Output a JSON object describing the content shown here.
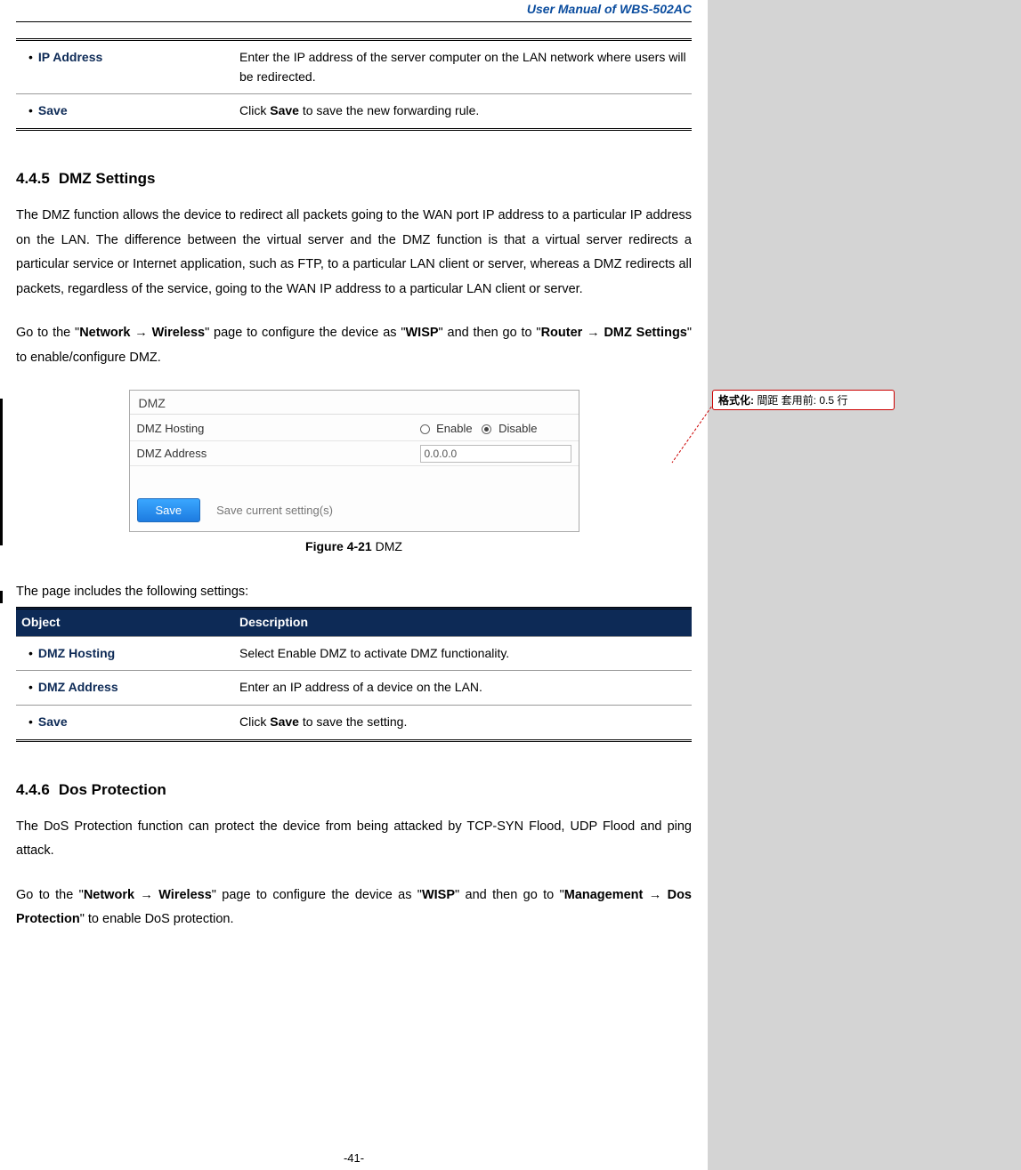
{
  "doc_title": "User Manual of WBS-502AC",
  "table1": {
    "rows": [
      {
        "obj": "IP Address",
        "desc": "Enter the IP address of the server computer on the LAN network where users will be redirected."
      },
      {
        "obj": "Save",
        "desc_pre": "Click ",
        "desc_bold": "Save",
        "desc_post": " to save the new forwarding rule."
      }
    ]
  },
  "sec445": {
    "number": "4.4.5",
    "title": "DMZ Settings",
    "para1": "The DMZ function allows the device to redirect all packets going to the WAN port IP address to a particular IP address on the LAN. The difference between the virtual server and the DMZ function is that a virtual server redirects a particular service or Internet application, such as FTP, to a particular LAN client or server, whereas a DMZ redirects all packets, regardless of the service, going to the WAN IP address to a particular LAN client or server.",
    "para2_pre": "Go to the \"",
    "para2_nav1a": "Network",
    "para2_nav1b": "Wireless",
    "para2_mid": "\" page to configure the device as \"",
    "para2_wisp": "WISP",
    "para2_mid2": "\" and then go to \"",
    "para2_nav2a": "Router",
    "para2_nav2b": "DMZ Settings",
    "para2_post": "\" to enable/configure DMZ."
  },
  "dmz_panel": {
    "title": "DMZ",
    "hosting_label": "DMZ Hosting",
    "enable_label": "Enable",
    "disable_label": "Disable",
    "addr_label": "DMZ Address",
    "addr_value": "0.0.0.0",
    "save_btn": "Save",
    "save_text": "Save current setting(s)"
  },
  "fig_caption": {
    "bold": "Figure 4-21",
    "rest": " DMZ"
  },
  "settings_intro": "The page includes the following settings:",
  "table2": {
    "head_obj": "Object",
    "head_desc": "Description",
    "rows": [
      {
        "obj": "DMZ Hosting",
        "desc": "Select Enable DMZ to activate DMZ functionality."
      },
      {
        "obj": "DMZ Address",
        "desc": "Enter an IP address of a device on the LAN."
      },
      {
        "obj": "Save",
        "desc_pre": "Click ",
        "desc_bold": "Save",
        "desc_post": " to save the setting."
      }
    ]
  },
  "sec446": {
    "number": "4.4.6",
    "title": "Dos Protection",
    "para1": "The DoS Protection function can protect the device from being attacked by TCP-SYN Flood, UDP Flood and ping attack.",
    "para2_pre": "Go to the \"",
    "para2_nav1a": "Network",
    "para2_nav1b": "Wireless",
    "para2_mid": "\" page to configure the device as \"",
    "para2_wisp": "WISP",
    "para2_mid2": "\" and then go to \"",
    "para2_nav2a": "Management",
    "para2_nav2b": "Dos Protection",
    "para2_post": "\" to enable DoS protection."
  },
  "comment": {
    "label": "格式化:",
    "text": " 間距 套用前:  0.5 行"
  },
  "page_number": "-41-"
}
